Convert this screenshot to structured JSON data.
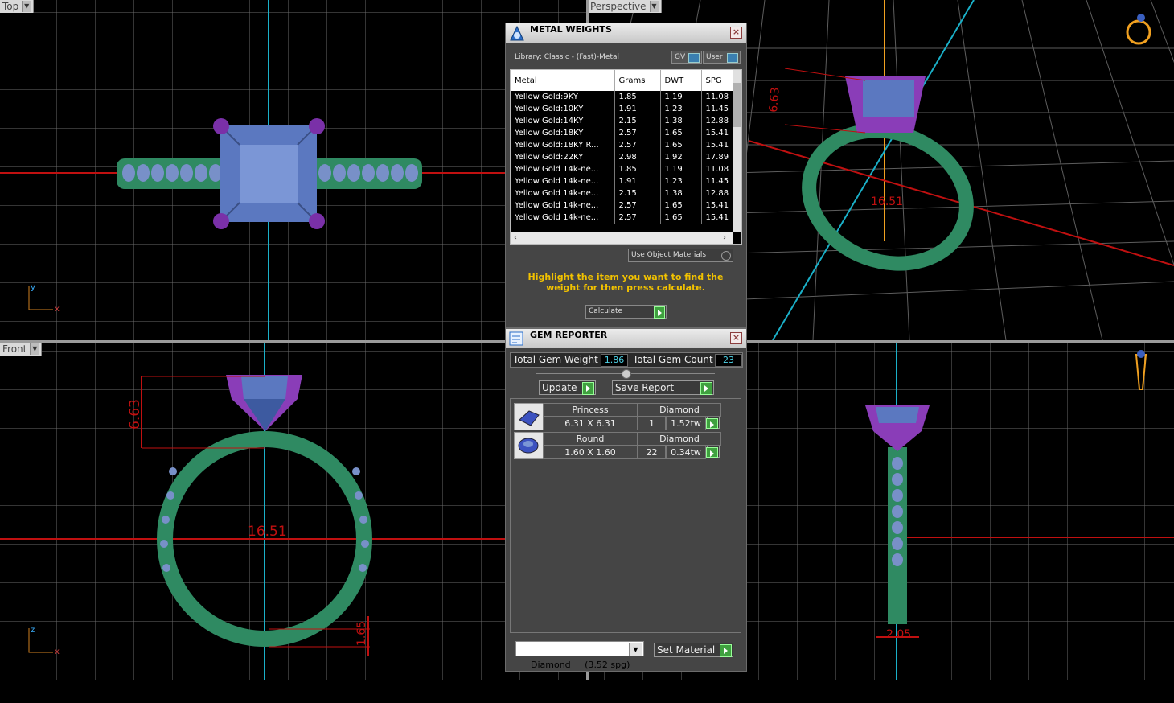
{
  "viewports": {
    "top": {
      "label": "Top",
      "axis_x": "x",
      "axis_y": "y"
    },
    "perspective": {
      "label": "Perspective"
    },
    "front": {
      "label": "Front",
      "axis_x": "x",
      "axis_y": "z",
      "dim_height": "6.63",
      "dim_width": "16.51",
      "dim_band": "1.65"
    },
    "side": {
      "dim_width": "2.05"
    }
  },
  "metal_weights": {
    "title": "METAL WEIGHTS",
    "library": "Library: Classic - (Fast)-Metal",
    "toggle_gv": "GV",
    "toggle_user": "User",
    "columns": [
      "Metal",
      "Grams",
      "DWT",
      "SPG"
    ],
    "rows": [
      [
        "Yellow Gold:9KY",
        "1.85",
        "1.19",
        "11.08"
      ],
      [
        "Yellow Gold:10KY",
        "1.91",
        "1.23",
        "11.45"
      ],
      [
        "Yellow Gold:14KY",
        "2.15",
        "1.38",
        "12.88"
      ],
      [
        "Yellow Gold:18KY",
        "2.57",
        "1.65",
        "15.41"
      ],
      [
        "Yellow Gold:18KY R...",
        "2.57",
        "1.65",
        "15.41"
      ],
      [
        "Yellow Gold:22KY",
        "2.98",
        "1.92",
        "17.89"
      ],
      [
        "Yellow Gold 14k-ne...",
        "1.85",
        "1.19",
        "11.08"
      ],
      [
        "Yellow Gold 14k-ne...",
        "1.91",
        "1.23",
        "11.45"
      ],
      [
        "Yellow Gold 14k-ne...",
        "2.15",
        "1.38",
        "12.88"
      ],
      [
        "Yellow Gold 14k-ne...",
        "2.57",
        "1.65",
        "15.41"
      ],
      [
        "Yellow Gold 14k-ne...",
        "2.57",
        "1.65",
        "15.41"
      ]
    ],
    "use_object_materials": "Use Object Materials",
    "hint": "Highlight the item you want to find the weight for then press calculate.",
    "calculate": "Calculate"
  },
  "gem_reporter": {
    "title": "GEM REPORTER",
    "total_weight_label": "Total Gem Weight",
    "total_weight": "1.86",
    "total_count_label": "Total Gem Count",
    "total_count": "23",
    "update": "Update",
    "save_report": "Save Report",
    "gems": [
      {
        "shape": "Princess",
        "material": "Diamond",
        "size": "6.31 X 6.31",
        "count": "1",
        "carat": "1.52tw"
      },
      {
        "shape": "Round",
        "material": "Diamond",
        "size": "1.60 X 1.60",
        "count": "22",
        "carat": "0.34tw"
      }
    ],
    "material_select": "Diamond     (3.52 spg)",
    "set_material": "Set Material"
  },
  "colors": {
    "grid": "#6a6a6a",
    "axis_red": "#d11",
    "axis_cyan": "#1ab0c8",
    "axis_orange": "#f0a020",
    "metal_green": "#2f8a62",
    "prong_purple": "#8a3db8",
    "gem_blue": "#5b78c0"
  }
}
